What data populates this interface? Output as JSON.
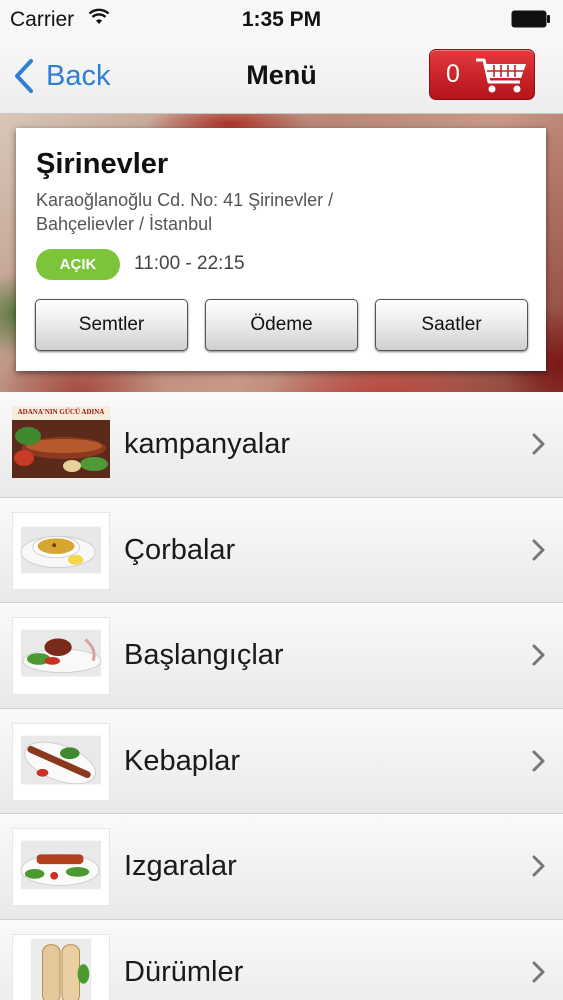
{
  "status_bar": {
    "carrier": "Carrier",
    "time": "1:35 PM",
    "wifi_icon": "wifi-icon",
    "battery_icon": "battery-icon"
  },
  "nav": {
    "back_label": "Back",
    "title": "Menü",
    "cart_count": "0",
    "cart_icon": "shopping-cart-icon"
  },
  "branch": {
    "name": "Şirinevler",
    "address": "Karaoğlanoğlu Cd. No: 41 Şirinevler / Bahçelievler / İstanbul",
    "status": "AÇIK",
    "hours": "11:00 - 22:15",
    "buttons": [
      "Semtler",
      "Ödeme",
      "Saatler"
    ]
  },
  "categories": [
    {
      "label": "kampanyalar",
      "image": "kebab-promo-image",
      "image_caption": "ADANA'NIN GÜCÜ ADINA"
    },
    {
      "label": "Çorbalar",
      "image": "soup-image"
    },
    {
      "label": "Başlangıçlar",
      "image": "starter-image"
    },
    {
      "label": "Kebaplar",
      "image": "kebab-plate-image"
    },
    {
      "label": "Izgaralar",
      "image": "grill-plate-image"
    },
    {
      "label": "Dürümler",
      "image": "wrap-image"
    }
  ],
  "colors": {
    "accent": "#2f7fd6",
    "cart_red": "#c8202a",
    "open_green": "#7cc43a"
  }
}
